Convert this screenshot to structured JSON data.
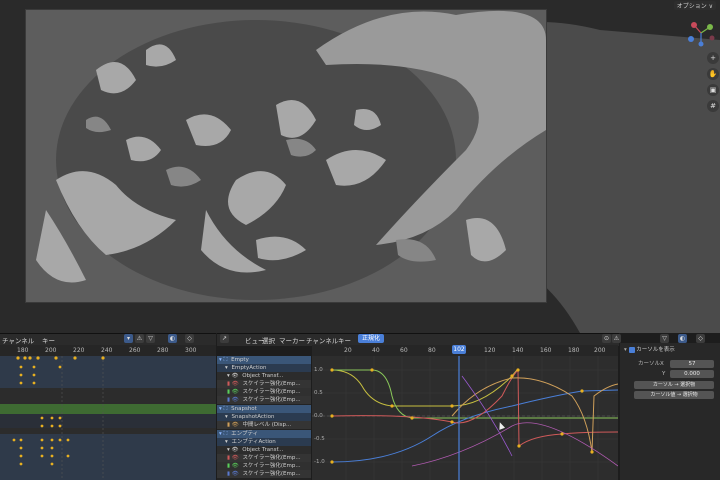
{
  "viewport": {
    "options_label": "オプション ∨",
    "gizmo_icons": [
      "grid-icon",
      "hand-icon",
      "camera-icon",
      "perspective-icon"
    ]
  },
  "dopesheet": {
    "menu": [
      "チャンネル",
      "キー"
    ],
    "ticks": [
      "180",
      "200",
      "220",
      "240",
      "260",
      "280",
      "300"
    ]
  },
  "graph": {
    "menu": [
      "ビュー",
      "選択",
      "マーカー",
      "チャンネル",
      "キー"
    ],
    "normalize_label": "正規化",
    "ticks": [
      "20",
      "40",
      "60",
      "80",
      "100",
      "120",
      "140",
      "160",
      "180",
      "200"
    ],
    "current_frame": "102",
    "y_labels": [
      "1.0",
      "0.5",
      "0.0",
      "-0.5",
      "-1.0"
    ]
  },
  "channels": [
    {
      "label": "Empty",
      "kind": "object",
      "indent": 0
    },
    {
      "label": "EmptyAction",
      "kind": "action",
      "indent": 1
    },
    {
      "label": "Object Transf...",
      "kind": "group",
      "indent": 2
    },
    {
      "label": "スケイラー強化(Emp...",
      "kind": "fcurve",
      "indent": 3,
      "color": "#d05a5a"
    },
    {
      "label": "スケイラー強化(Emp...",
      "kind": "fcurve",
      "indent": 3,
      "color": "#5ad05a"
    },
    {
      "label": "スケイラー強化(Emp...",
      "kind": "fcurve",
      "indent": 3,
      "color": "#5a7ad0"
    },
    {
      "label": "Snapshot",
      "kind": "object",
      "indent": 0
    },
    {
      "label": "SnapshotAction",
      "kind": "action",
      "indent": 1
    },
    {
      "label": "中間レベル (Disp...",
      "kind": "fcurve",
      "indent": 3,
      "color": "#d0a05a"
    },
    {
      "label": "エンプティ",
      "kind": "object",
      "indent": 0
    },
    {
      "label": "エンプティAction",
      "kind": "action",
      "indent": 1
    },
    {
      "label": "Object Transf...",
      "kind": "group",
      "indent": 2
    },
    {
      "label": "スケイラー強化(Emp...",
      "kind": "fcurve",
      "indent": 3,
      "color": "#d05a5a"
    },
    {
      "label": "スケイラー強化(Emp...",
      "kind": "fcurve",
      "indent": 3,
      "color": "#5ad05a"
    },
    {
      "label": "スケイラー強化(Emp...",
      "kind": "fcurve",
      "indent": 3,
      "color": "#5a7ad0"
    }
  ],
  "npanel": {
    "section_label": "カーソルを表示",
    "cursor_x_label": "カーソルX",
    "cursor_x_value": "57",
    "value_label": "Y",
    "value_value": "0.000",
    "btn_cursor_to_selected": "カーソル → 選択物",
    "btn_cursor_value_to_selected": "カーソル値 → 選択物"
  },
  "colors": {
    "accent": "#4a7fd8",
    "header": "#2b2b2b",
    "keyframe": "#e8b020",
    "playhead": "#4a7fd8"
  }
}
